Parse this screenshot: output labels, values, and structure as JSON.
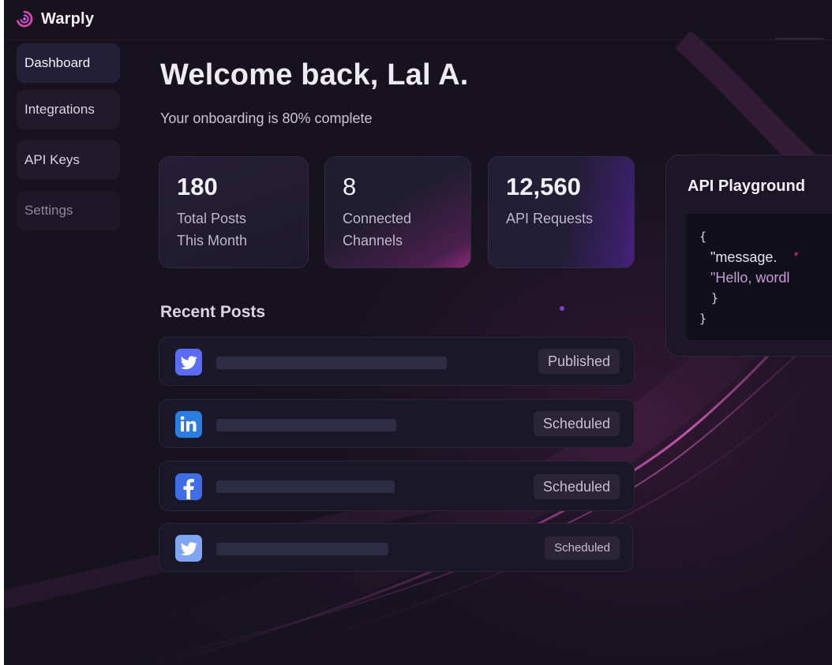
{
  "app": {
    "brand": "Warply"
  },
  "sidebar": {
    "items": [
      {
        "label": "Dashboard"
      },
      {
        "label": "Integrations"
      },
      {
        "label": "API Keys"
      },
      {
        "label": "Settings"
      }
    ]
  },
  "main": {
    "title": "Welcome back, Lal A.",
    "subtitle": "Your onboarding is 80% complete",
    "onboarding_progress_percent": 80
  },
  "stats": [
    {
      "value": "180",
      "label_line1": "Total Posts",
      "label_line2": "This Month"
    },
    {
      "value": "8",
      "label_line1": "Connected",
      "label_line2": "Channels"
    },
    {
      "value": "12,560",
      "label_line1": "API Requests",
      "label_line2": ""
    }
  ],
  "recent_posts": {
    "title": "Recent Posts",
    "items": [
      {
        "channel_icon": "twitter-icon",
        "status": "Published"
      },
      {
        "channel_icon": "linkedin-icon",
        "status": "Scheduled"
      },
      {
        "channel_icon": "facebook-icon",
        "status": "Scheduled"
      },
      {
        "channel_icon": "twitter-icon",
        "status": "Scheduled"
      }
    ]
  },
  "playground": {
    "title": "API Playground",
    "code": {
      "open": "{",
      "key": "\"message.",
      "value": "\"Hello, wordl",
      "inner_close": "}",
      "close": "}"
    }
  },
  "colors": {
    "background": "#16131f",
    "accent_magenta": "#c13a9a",
    "twitter": "#5b6cf5",
    "linkedin": "#2a7de1",
    "facebook": "#3d6ee6"
  }
}
